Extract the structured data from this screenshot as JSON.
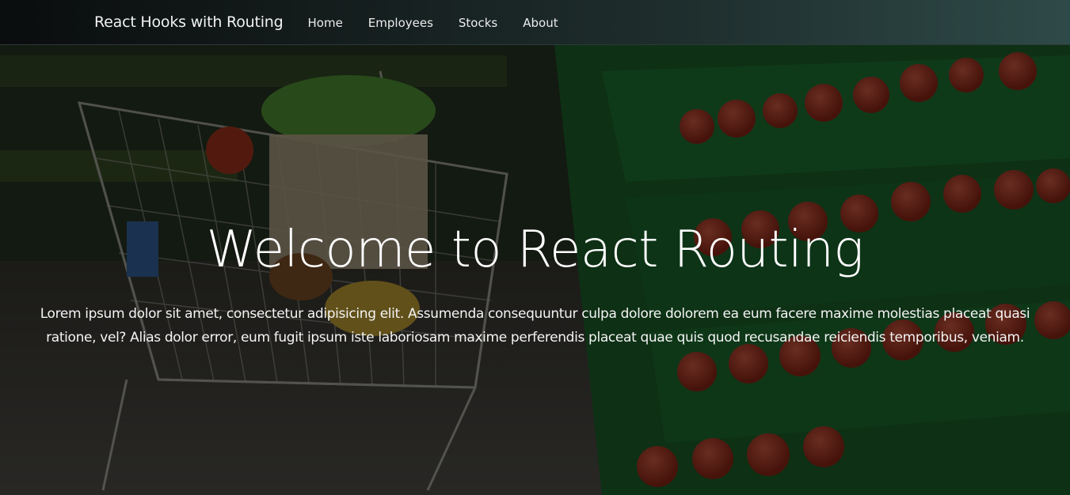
{
  "navbar": {
    "brand": "React Hooks with Routing",
    "links": [
      {
        "label": "Home"
      },
      {
        "label": "Employees"
      },
      {
        "label": "Stocks"
      },
      {
        "label": "About"
      }
    ]
  },
  "hero": {
    "title": "Welcome to React Routing",
    "text": "Lorem ipsum dolor sit amet, consectetur adipisicing elit. Assumenda consequuntur culpa dolore dolorem ea eum facere maxime molestias placeat quasi ratione, vel? Alias dolor error, eum fugit ipsum iste laboriosam maxime perferendis placeat quae quis quod recusandae reiciendis temporibus, veniam."
  },
  "colors": {
    "navbar_start": "#0a0d0d",
    "navbar_end": "#2e4a48",
    "text": "#ffffff",
    "crate_green": "#1f6b2f",
    "produce_red": "#b5361f"
  }
}
